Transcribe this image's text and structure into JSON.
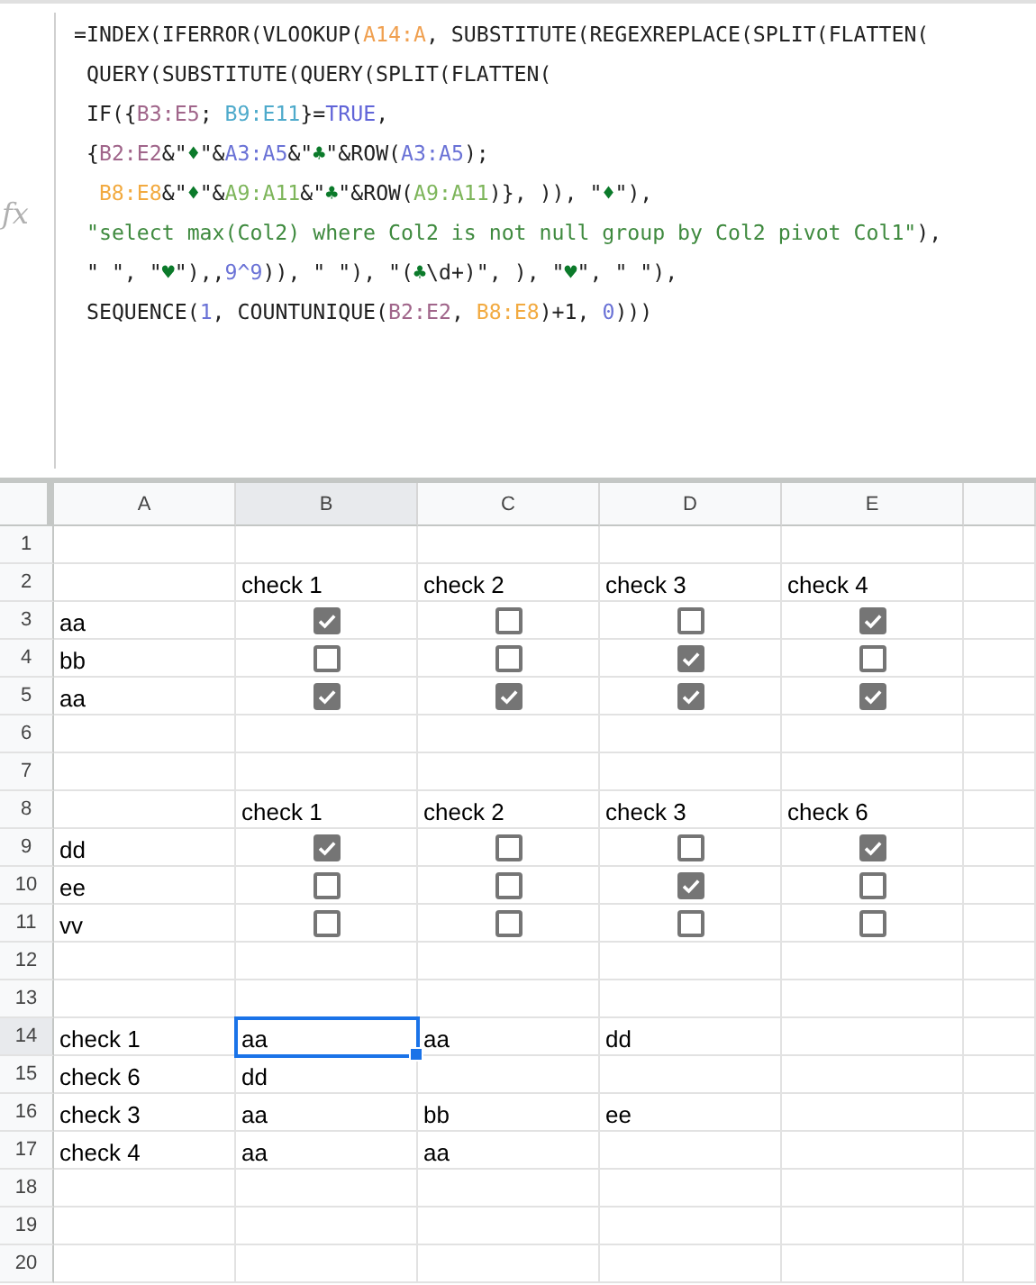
{
  "formula_bar": {
    "label": "fx",
    "lines": [
      [
        {
          "text": "=INDEX(IFERROR(VLOOKUP(",
          "color": "#222222"
        },
        {
          "text": "A14:A",
          "color": "#f0a050"
        },
        {
          "text": ", SUBSTITUTE(REGEXREPLACE(SPLIT(FLATTEN(",
          "color": "#222222"
        }
      ],
      [
        {
          "text": " QUERY(SUBSTITUTE(QUERY(SPLIT(FLATTEN(",
          "color": "#222222"
        }
      ],
      [
        {
          "text": " IF({",
          "color": "#222222"
        },
        {
          "text": "B3:E5",
          "color": "#a0658a"
        },
        {
          "text": "; ",
          "color": "#222222"
        },
        {
          "text": "B9:E11",
          "color": "#4eaacb"
        },
        {
          "text": "}=",
          "color": "#222222"
        },
        {
          "text": "TRUE",
          "color": "#6064d8"
        },
        {
          "text": ",",
          "color": "#222222"
        }
      ],
      [
        {
          "text": " {",
          "color": "#222222"
        },
        {
          "text": "B2:E2",
          "color": "#a0658a"
        },
        {
          "text": "&\"",
          "color": "#222222"
        },
        {
          "text": "♦",
          "color": "#0b7a2a"
        },
        {
          "text": "\"&",
          "color": "#222222"
        },
        {
          "text": "A3:A5",
          "color": "#6a72d6"
        },
        {
          "text": "&\"",
          "color": "#222222"
        },
        {
          "text": "♣",
          "color": "#0b7a2a"
        },
        {
          "text": "\"&ROW(",
          "color": "#222222"
        },
        {
          "text": "A3:A5",
          "color": "#6a72d6"
        },
        {
          "text": ");",
          "color": "#222222"
        }
      ],
      [
        {
          "text": "B8:E8",
          "color": "#f2aa40"
        },
        {
          "text": "&\"",
          "color": "#222222"
        },
        {
          "text": "♦",
          "color": "#0b7a2a"
        },
        {
          "text": "\"&",
          "color": "#222222"
        },
        {
          "text": "A9:A11",
          "color": "#7db55a"
        },
        {
          "text": "&\"",
          "color": "#222222"
        },
        {
          "text": "♣",
          "color": "#0b7a2a"
        },
        {
          "text": "\"&ROW(",
          "color": "#222222"
        },
        {
          "text": "A9:A11",
          "color": "#7db55a"
        },
        {
          "text": ")}, )), \"",
          "color": "#222222"
        },
        {
          "text": "♦",
          "color": "#0b7a2a"
        },
        {
          "text": "\"),",
          "color": "#222222"
        }
      ],
      [
        {
          "text": " \"select max(Col2) where Col2 is not null group by Col2 pivot Col1\"",
          "color": "#3f8a3f"
        },
        {
          "text": "),",
          "color": "#222222"
        }
      ],
      [
        {
          "text": " \" \", \"",
          "color": "#222222"
        },
        {
          "text": "♥",
          "color": "#0b7a2a"
        },
        {
          "text": "\"),,",
          "color": "#222222"
        },
        {
          "text": "9^9",
          "color": "#6a72d6"
        },
        {
          "text": ")), \" \"), \"(",
          "color": "#222222"
        },
        {
          "text": "♣",
          "color": "#0b7a2a"
        },
        {
          "text": "\\d+)\", ), \"",
          "color": "#222222"
        },
        {
          "text": "♥",
          "color": "#0b7a2a"
        },
        {
          "text": "\", \" \"),",
          "color": "#222222"
        }
      ],
      [
        {
          "text": " SEQUENCE(",
          "color": "#222222"
        },
        {
          "text": "1",
          "color": "#6a72d6"
        },
        {
          "text": ", COUNTUNIQUE(",
          "color": "#222222"
        },
        {
          "text": "B2:E2",
          "color": "#a0658a"
        },
        {
          "text": ", ",
          "color": "#222222"
        },
        {
          "text": "B8:E8",
          "color": "#f2aa40"
        },
        {
          "text": ")+1, ",
          "color": "#222222"
        },
        {
          "text": "0",
          "color": "#6a72d6"
        },
        {
          "text": ")))",
          "color": "#222222"
        }
      ]
    ]
  },
  "grid": {
    "columns": [
      {
        "label": "A",
        "selected": false
      },
      {
        "label": "B",
        "selected": true
      },
      {
        "label": "C",
        "selected": false
      },
      {
        "label": "D",
        "selected": false
      },
      {
        "label": "E",
        "selected": false
      }
    ],
    "rows": [
      {
        "label": "1",
        "selected": false,
        "cells": [
          {
            "kind": "blank",
            "selected": false
          },
          {
            "kind": "blank",
            "selected": false
          },
          {
            "kind": "blank",
            "selected": false
          },
          {
            "kind": "blank",
            "selected": false
          },
          {
            "kind": "blank",
            "selected": false
          }
        ]
      },
      {
        "label": "2",
        "selected": false,
        "cells": [
          {
            "kind": "blank",
            "selected": false
          },
          {
            "kind": "text",
            "text": "check 1",
            "selected": false
          },
          {
            "kind": "text",
            "text": "check 2",
            "selected": false
          },
          {
            "kind": "text",
            "text": "check 3",
            "selected": false
          },
          {
            "kind": "text",
            "text": "check 4",
            "selected": false
          }
        ]
      },
      {
        "label": "3",
        "selected": false,
        "cells": [
          {
            "kind": "text",
            "text": "aa",
            "selected": false
          },
          {
            "kind": "checkbox",
            "checked": true,
            "selected": false
          },
          {
            "kind": "checkbox",
            "checked": false,
            "selected": false
          },
          {
            "kind": "checkbox",
            "checked": false,
            "selected": false
          },
          {
            "kind": "checkbox",
            "checked": true,
            "selected": false
          }
        ]
      },
      {
        "label": "4",
        "selected": false,
        "cells": [
          {
            "kind": "text",
            "text": "bb",
            "selected": false
          },
          {
            "kind": "checkbox",
            "checked": false,
            "selected": false
          },
          {
            "kind": "checkbox",
            "checked": false,
            "selected": false
          },
          {
            "kind": "checkbox",
            "checked": true,
            "selected": false
          },
          {
            "kind": "checkbox",
            "checked": false,
            "selected": false
          }
        ]
      },
      {
        "label": "5",
        "selected": false,
        "cells": [
          {
            "kind": "text",
            "text": "aa",
            "selected": false
          },
          {
            "kind": "checkbox",
            "checked": true,
            "selected": false
          },
          {
            "kind": "checkbox",
            "checked": true,
            "selected": false
          },
          {
            "kind": "checkbox",
            "checked": true,
            "selected": false
          },
          {
            "kind": "checkbox",
            "checked": true,
            "selected": false
          }
        ]
      },
      {
        "label": "6",
        "selected": false,
        "cells": [
          {
            "kind": "blank",
            "selected": false
          },
          {
            "kind": "blank",
            "selected": false
          },
          {
            "kind": "blank",
            "selected": false
          },
          {
            "kind": "blank",
            "selected": false
          },
          {
            "kind": "blank",
            "selected": false
          }
        ]
      },
      {
        "label": "7",
        "selected": false,
        "cells": [
          {
            "kind": "blank",
            "selected": false
          },
          {
            "kind": "blank",
            "selected": false
          },
          {
            "kind": "blank",
            "selected": false
          },
          {
            "kind": "blank",
            "selected": false
          },
          {
            "kind": "blank",
            "selected": false
          }
        ]
      },
      {
        "label": "8",
        "selected": false,
        "cells": [
          {
            "kind": "blank",
            "selected": false
          },
          {
            "kind": "text",
            "text": "check 1",
            "selected": false
          },
          {
            "kind": "text",
            "text": "check 2",
            "selected": false
          },
          {
            "kind": "text",
            "text": "check 3",
            "selected": false
          },
          {
            "kind": "text",
            "text": "check 6",
            "selected": false
          }
        ]
      },
      {
        "label": "9",
        "selected": false,
        "cells": [
          {
            "kind": "text",
            "text": "dd",
            "selected": false
          },
          {
            "kind": "checkbox",
            "checked": true,
            "selected": false
          },
          {
            "kind": "checkbox",
            "checked": false,
            "selected": false
          },
          {
            "kind": "checkbox",
            "checked": false,
            "selected": false
          },
          {
            "kind": "checkbox",
            "checked": true,
            "selected": false
          }
        ]
      },
      {
        "label": "10",
        "selected": false,
        "cells": [
          {
            "kind": "text",
            "text": "ee",
            "selected": false
          },
          {
            "kind": "checkbox",
            "checked": false,
            "selected": false
          },
          {
            "kind": "checkbox",
            "checked": false,
            "selected": false
          },
          {
            "kind": "checkbox",
            "checked": true,
            "selected": false
          },
          {
            "kind": "checkbox",
            "checked": false,
            "selected": false
          }
        ]
      },
      {
        "label": "11",
        "selected": false,
        "cells": [
          {
            "kind": "text",
            "text": "vv",
            "selected": false
          },
          {
            "kind": "checkbox",
            "checked": false,
            "selected": false
          },
          {
            "kind": "checkbox",
            "checked": false,
            "selected": false
          },
          {
            "kind": "checkbox",
            "checked": false,
            "selected": false
          },
          {
            "kind": "checkbox",
            "checked": false,
            "selected": false
          }
        ]
      },
      {
        "label": "12",
        "selected": false,
        "cells": [
          {
            "kind": "blank",
            "selected": false
          },
          {
            "kind": "blank",
            "selected": false
          },
          {
            "kind": "blank",
            "selected": false
          },
          {
            "kind": "blank",
            "selected": false
          },
          {
            "kind": "blank",
            "selected": false
          }
        ]
      },
      {
        "label": "13",
        "selected": false,
        "cells": [
          {
            "kind": "blank",
            "selected": false
          },
          {
            "kind": "blank",
            "selected": false
          },
          {
            "kind": "blank",
            "selected": false
          },
          {
            "kind": "blank",
            "selected": false
          },
          {
            "kind": "blank",
            "selected": false
          }
        ]
      },
      {
        "label": "14",
        "selected": true,
        "cells": [
          {
            "kind": "text",
            "text": "check 1",
            "selected": false
          },
          {
            "kind": "text",
            "text": "aa",
            "selected": true
          },
          {
            "kind": "text",
            "text": "aa",
            "selected": false
          },
          {
            "kind": "text",
            "text": "dd",
            "selected": false
          },
          {
            "kind": "blank",
            "selected": false
          }
        ]
      },
      {
        "label": "15",
        "selected": false,
        "cells": [
          {
            "kind": "text",
            "text": "check 6",
            "selected": false
          },
          {
            "kind": "text",
            "text": "dd",
            "selected": false
          },
          {
            "kind": "blank",
            "selected": false
          },
          {
            "kind": "blank",
            "selected": false
          },
          {
            "kind": "blank",
            "selected": false
          }
        ]
      },
      {
        "label": "16",
        "selected": false,
        "cells": [
          {
            "kind": "text",
            "text": "check 3",
            "selected": false
          },
          {
            "kind": "text",
            "text": "aa",
            "selected": false
          },
          {
            "kind": "text",
            "text": "bb",
            "selected": false
          },
          {
            "kind": "text",
            "text": "ee",
            "selected": false
          },
          {
            "kind": "blank",
            "selected": false
          }
        ]
      },
      {
        "label": "17",
        "selected": false,
        "cells": [
          {
            "kind": "text",
            "text": "check 4",
            "selected": false
          },
          {
            "kind": "text",
            "text": "aa",
            "selected": false
          },
          {
            "kind": "text",
            "text": "aa",
            "selected": false
          },
          {
            "kind": "blank",
            "selected": false
          },
          {
            "kind": "blank",
            "selected": false
          }
        ]
      },
      {
        "label": "18",
        "selected": false,
        "cells": [
          {
            "kind": "blank",
            "selected": false
          },
          {
            "kind": "blank",
            "selected": false
          },
          {
            "kind": "blank",
            "selected": false
          },
          {
            "kind": "blank",
            "selected": false
          },
          {
            "kind": "blank",
            "selected": false
          }
        ]
      },
      {
        "label": "19",
        "selected": false,
        "cells": [
          {
            "kind": "blank",
            "selected": false
          },
          {
            "kind": "blank",
            "selected": false
          },
          {
            "kind": "blank",
            "selected": false
          },
          {
            "kind": "blank",
            "selected": false
          },
          {
            "kind": "blank",
            "selected": false
          }
        ]
      },
      {
        "label": "20",
        "selected": false,
        "cells": [
          {
            "kind": "blank",
            "selected": false
          },
          {
            "kind": "blank",
            "selected": false
          },
          {
            "kind": "blank",
            "selected": false
          },
          {
            "kind": "blank",
            "selected": false
          },
          {
            "kind": "blank",
            "selected": false
          }
        ]
      }
    ]
  }
}
